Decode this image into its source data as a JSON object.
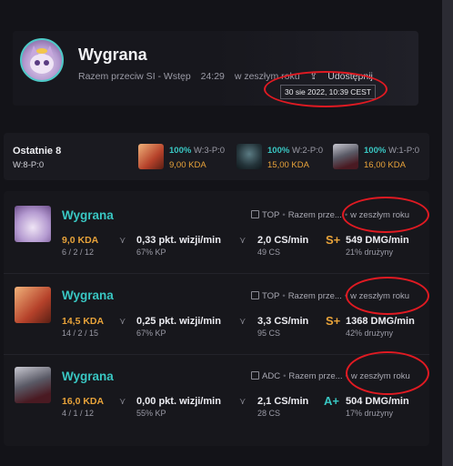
{
  "header": {
    "result": "Wygrana",
    "queue": "Razem przeciw SI - Wstęp",
    "duration": "24:29",
    "when": "w zeszłym roku",
    "share_label": "Udostępnij",
    "tooltip": "30 sie 2022, 10:39 CEST"
  },
  "summary": {
    "title": "Ostatnie 8",
    "record": "W:8-P:0",
    "champs": [
      {
        "pct": "100%",
        "rec": "W:3-P:0",
        "kda": "9,00 KDA"
      },
      {
        "pct": "100%",
        "rec": "W:2-P:0",
        "kda": "15,00 KDA"
      },
      {
        "pct": "100%",
        "rec": "W:1-P:0",
        "kda": "16,00 KDA"
      }
    ]
  },
  "games": [
    {
      "result": "Wygrana",
      "kda": "9,0 KDA",
      "kda_line": "6 / 2 / 12",
      "role": "TOP",
      "queue": "Razem prze...",
      "when": "w zeszłym roku",
      "vision": "0,33 pkt. wizji/min",
      "kp": "67% KP",
      "cs": "2,0 CS/min",
      "cs_total": "49 CS",
      "grade": "S+",
      "dmg": "549 DMG/min",
      "dmg_share": "21% drużyny"
    },
    {
      "result": "Wygrana",
      "kda": "14,5 KDA",
      "kda_line": "14 / 2 / 15",
      "role": "TOP",
      "queue": "Razem prze...",
      "when": "w zeszłym roku",
      "vision": "0,25 pkt. wizji/min",
      "kp": "67% KP",
      "cs": "3,3 CS/min",
      "cs_total": "95 CS",
      "grade": "S+",
      "dmg": "1368 DMG/min",
      "dmg_share": "42% drużyny"
    },
    {
      "result": "Wygrana",
      "kda": "16,0 KDA",
      "kda_line": "4 / 1 / 12",
      "role": "ADC",
      "queue": "Razem prze...",
      "when": "w zeszłym roku",
      "vision": "0,00 pkt. wizji/min",
      "kp": "55% KP",
      "cs": "2,1 CS/min",
      "cs_total": "28 CS",
      "grade": "A+",
      "dmg": "504 DMG/min",
      "dmg_share": "17% drużyny"
    }
  ],
  "colors": {
    "accent": "#39c7c3",
    "kda": "#e8a33a",
    "grade_s": "#e8a33a",
    "grade_a": "#39c7c3",
    "highlight_ring": "#e01a22"
  }
}
